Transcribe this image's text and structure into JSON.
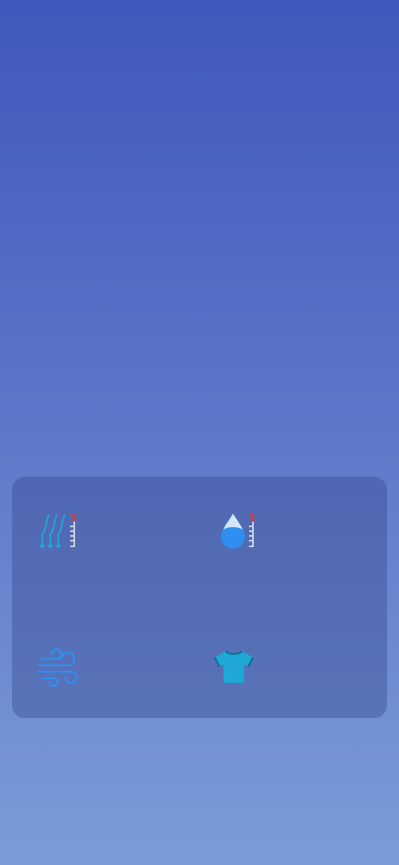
{
  "theme": {
    "bg_top": "#3f58bd",
    "bg_bottom": "#7b9bd8",
    "card_bg": "rgba(60,80,150,0.45)",
    "icon_cyan": "#1fa7d6",
    "icon_blue": "#2f8ff0",
    "thermo_red": "#e53935",
    "thermo_gray": "#cfd6e2"
  },
  "details": {
    "items": [
      {
        "icon": "dew-point-icon"
      },
      {
        "icon": "humidity-icon"
      },
      {
        "icon": "wind-icon"
      },
      {
        "icon": "clothing-icon"
      }
    ]
  }
}
